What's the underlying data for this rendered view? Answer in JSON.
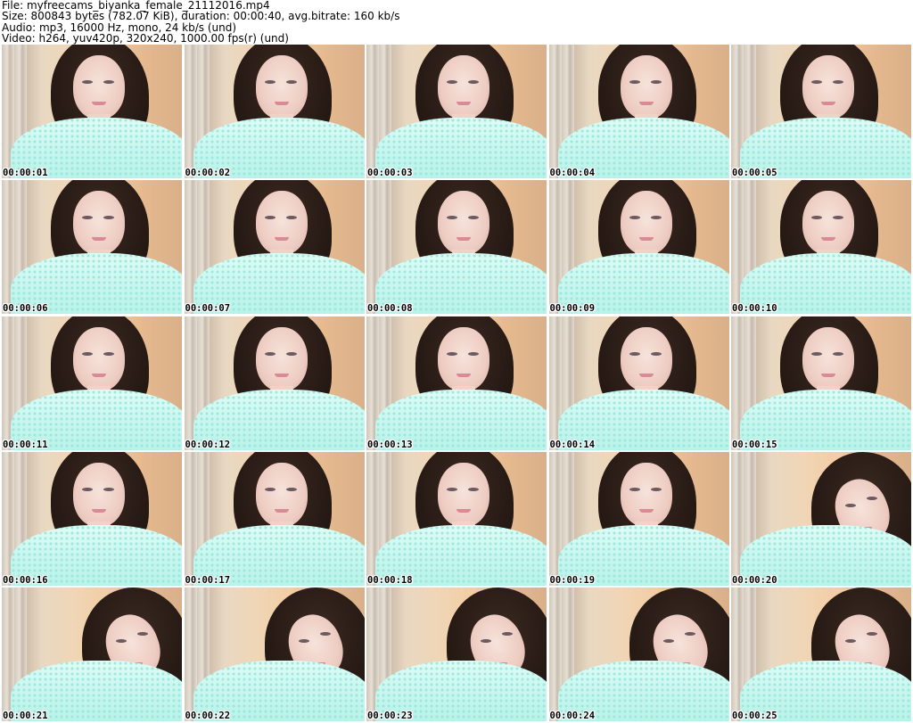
{
  "header": {
    "file": "File: myfreecams_biyanka_female_21112016.mp4",
    "size": "Size: 800843 bytes (782.07 KiB), duration: 00:00:40, avg.bitrate: 160 kb/s",
    "audio": "Audio: mp3, 16000 Hz, mono, 24 kb/s (und)",
    "video": "Video: h264, yuv420p, 320x240, 1000.00 fps(r) (und)"
  },
  "thumbnails": [
    {
      "timestamp": "00:00:01"
    },
    {
      "timestamp": "00:00:02"
    },
    {
      "timestamp": "00:00:03"
    },
    {
      "timestamp": "00:00:04"
    },
    {
      "timestamp": "00:00:05"
    },
    {
      "timestamp": "00:00:06"
    },
    {
      "timestamp": "00:00:07"
    },
    {
      "timestamp": "00:00:08"
    },
    {
      "timestamp": "00:00:09"
    },
    {
      "timestamp": "00:00:10"
    },
    {
      "timestamp": "00:00:11"
    },
    {
      "timestamp": "00:00:12"
    },
    {
      "timestamp": "00:00:13"
    },
    {
      "timestamp": "00:00:14"
    },
    {
      "timestamp": "00:00:15"
    },
    {
      "timestamp": "00:00:16"
    },
    {
      "timestamp": "00:00:17"
    },
    {
      "timestamp": "00:00:18"
    },
    {
      "timestamp": "00:00:19"
    },
    {
      "timestamp": "00:00:20"
    },
    {
      "timestamp": "00:00:21"
    },
    {
      "timestamp": "00:00:22"
    },
    {
      "timestamp": "00:00:23"
    },
    {
      "timestamp": "00:00:24"
    },
    {
      "timestamp": "00:00:25"
    }
  ]
}
